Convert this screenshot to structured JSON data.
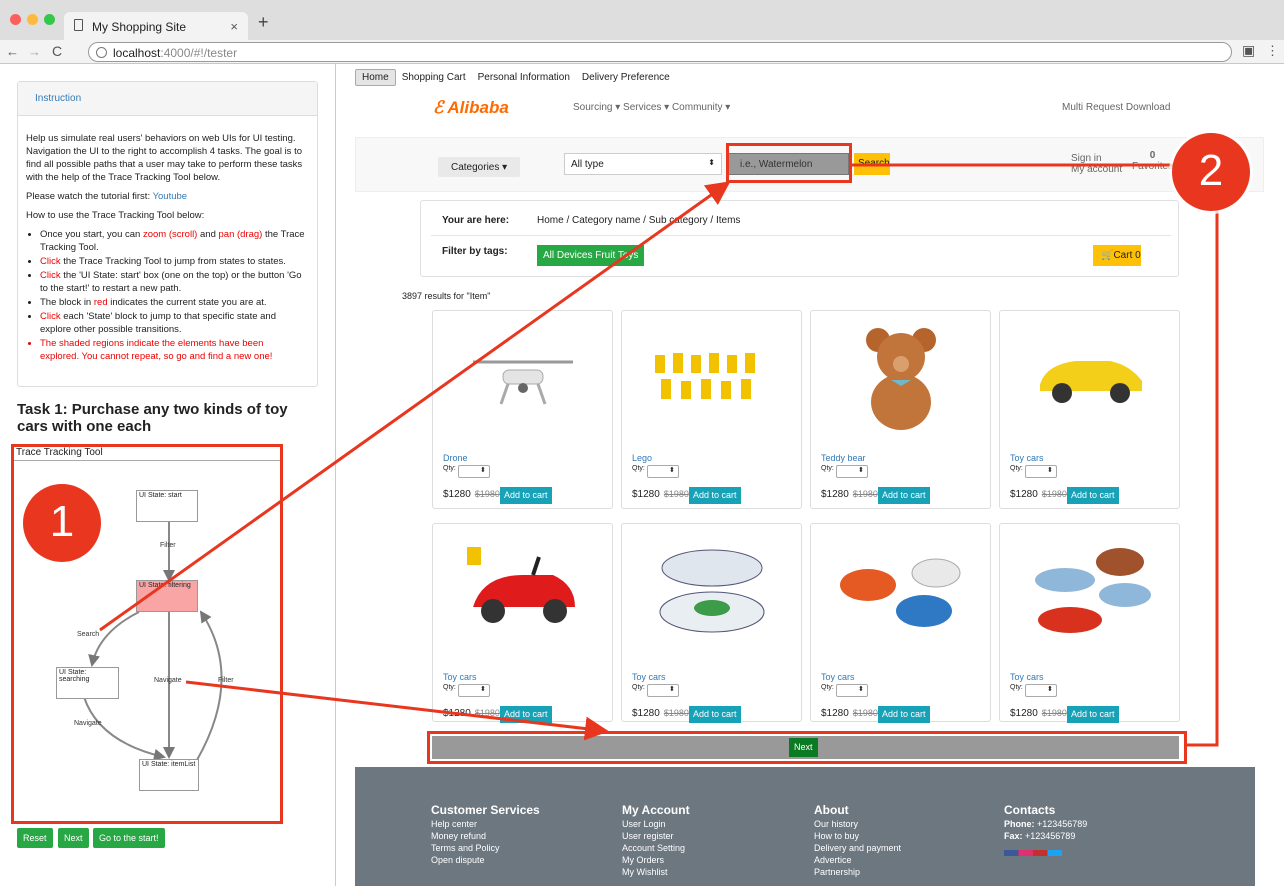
{
  "browser": {
    "tab_title": "My Shopping Site",
    "url_host": "localhost",
    "url_rest": ":4000/#!/tester"
  },
  "instruction": {
    "header": "Instruction",
    "p1": "Help us simulate real users' behaviors on web UIs for UI testing. Navigation the UI to the right to accomplish 4 tasks. The goal is to find all possible paths that a user may take to perform these tasks with the help of the Trace Tracking Tool below.",
    "p2_pre": "Please watch the tutorial first: ",
    "p2_link": "Youtube",
    "p3": "How to use the Trace Tracking Tool below:",
    "b1_a": "Once you start, you can ",
    "b1_r1": "zoom (scroll)",
    "b1_b": " and ",
    "b1_r2": "pan (drag)",
    "b1_c": " the Trace Tracking Tool.",
    "b2_r": "Click",
    "b2_rest": " the Trace Tracking Tool to jump from states to states.",
    "b3_r": "Click",
    "b3_rest": " the 'UI State: start' box (one on the top) or the button 'Go to the start!' to restart a new path.",
    "b4_a": "The block in ",
    "b4_r": "red",
    "b4_b": " indicates the current state you are at.",
    "b5_r": "Click",
    "b5_rest": " each 'State' block to jump to that specific state and explore other possible transitions.",
    "b6": "The shaded regions indicate the elements have been explored. You cannot repeat, so go and find a new one!"
  },
  "task": "Task 1: Purchase any two kinds of toy cars with one each",
  "tool": {
    "title": "Trace Tracking Tool",
    "s_start": "UI State: start",
    "s_filter": "UI State: filtering",
    "s_search": "UI State: searching",
    "s_list": "UI State: itemList",
    "e_filter": "Filter",
    "e_search": "Search",
    "e_nav1": "Navigate",
    "e_nav2": "Navigate",
    "e_filter2": "Filter"
  },
  "buttons": {
    "reset": "Reset",
    "next": "Next",
    "start": "Go to the start!"
  },
  "site": {
    "nav": [
      "Home",
      "Shopping Cart",
      "Personal Information",
      "Delivery Preference"
    ],
    "logo": "Alibaba",
    "menu": "Sourcing ▾   Services ▾   Community ▾",
    "topright": "Multi Request   Download",
    "categories": "Categories ▾",
    "type": "All type",
    "search_ph": "i.e., Watermelon",
    "search_btn": "Search",
    "signin": "Sign in",
    "account": "My account",
    "fav_count": "0",
    "fav": "Favorites",
    "here_label": "Your are here:",
    "crumb": "Home  /  Category name  /  Sub category  /  Items",
    "filter_label": "Filter by tags:",
    "tags": "All   Devices   Fruit   Toys",
    "cart": "Cart 0",
    "results": "3897 results for \"Item\"",
    "qty": "Qty:",
    "price": "$1280",
    "old": "$1980",
    "add": "Add to cart",
    "items": [
      "Drone",
      "Lego",
      "Teddy bear",
      "Toy cars",
      "Toy cars",
      "Toy cars",
      "Toy cars",
      "Toy cars"
    ],
    "next": "Next"
  },
  "footer": {
    "c1": {
      "h": "Customer Services",
      "l": [
        "Help center",
        "Money refund",
        "Terms and Policy",
        "Open dispute"
      ]
    },
    "c2": {
      "h": "My Account",
      "l": [
        "User Login",
        "User register",
        "Account Setting",
        "My Orders",
        "My Wishlist"
      ]
    },
    "c3": {
      "h": "About",
      "l": [
        "Our history",
        "How to buy",
        "Delivery and payment",
        "Advertice",
        "Partnership"
      ]
    },
    "c4": {
      "h": "Contacts",
      "phone_l": "Phone:",
      "phone": " +123456789",
      "fax_l": "Fax:",
      "fax": " +123456789"
    }
  },
  "badges": {
    "one": "1",
    "two": "2"
  },
  "colors": {
    "annotation": "#e8361f",
    "green": "#28a745",
    "yellow": "#ffc107",
    "teal": "#17a2b8"
  }
}
